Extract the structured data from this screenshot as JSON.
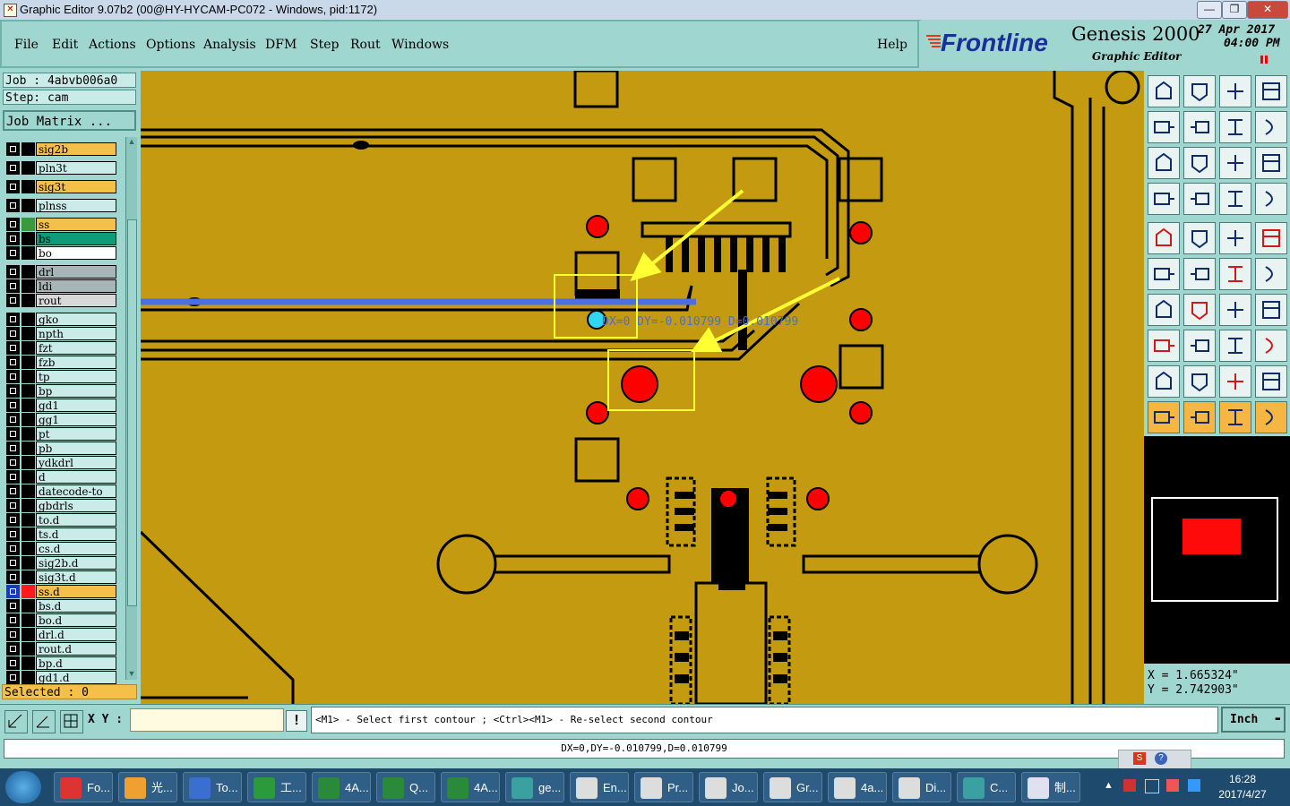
{
  "window": {
    "title": "Graphic Editor 9.07b2 (00@HY-HYCAM-PC072 - Windows, pid:1172)",
    "controls": [
      "—",
      "❐",
      "✕"
    ]
  },
  "menubar": {
    "items": [
      "File",
      "Edit",
      "Actions",
      "Options",
      "Analysis",
      "DFM",
      "Step",
      "Rout",
      "Windows"
    ],
    "help": "Help"
  },
  "brand": {
    "logo": "Frontline",
    "product": "Genesis 2000",
    "subtitle": "Graphic Editor",
    "date": "27 Apr 2017",
    "time": "04:00 PM"
  },
  "job": {
    "job_label": "Job : 4abvb006a0",
    "step_label": "Step: cam",
    "matrix_button": "Job Matrix ...",
    "selected": "Selected : 0"
  },
  "layers": [
    {
      "name": "sig2b",
      "color": "#f5c04a",
      "swatch": "#000000"
    },
    {
      "name": "pln3t",
      "color": "#c9ece8",
      "swatch": "#000000"
    },
    {
      "name": "sig3t",
      "color": "#f5c04a",
      "swatch": "#000000"
    },
    {
      "name": "plnss",
      "color": "#c9ece8",
      "swatch": "#000000"
    },
    {
      "name": "ss",
      "color": "#f5c04a",
      "swatch": "#3a9a3a"
    },
    {
      "name": "bs",
      "color": "#0f9a7a",
      "swatch": "#000000"
    },
    {
      "name": "bo",
      "color": "#ffffff",
      "swatch": "#000000"
    },
    {
      "name": "drl",
      "color": "#a9b4b6",
      "swatch": "#000000"
    },
    {
      "name": "ldi",
      "color": "#a9b4b6",
      "swatch": "#000000"
    },
    {
      "name": "rout",
      "color": "#d8d8d8",
      "swatch": "#000000"
    },
    {
      "name": "gko",
      "color": "#c9ece8",
      "swatch": "#000000"
    },
    {
      "name": "npth",
      "color": "#c9ece8",
      "swatch": "#000000"
    },
    {
      "name": "fzt",
      "color": "#c9ece8",
      "swatch": "#000000"
    },
    {
      "name": "fzb",
      "color": "#c9ece8",
      "swatch": "#000000"
    },
    {
      "name": "tp",
      "color": "#c9ece8",
      "swatch": "#000000"
    },
    {
      "name": "bp",
      "color": "#c9ece8",
      "swatch": "#000000"
    },
    {
      "name": "gd1",
      "color": "#c9ece8",
      "swatch": "#000000"
    },
    {
      "name": "gg1",
      "color": "#c9ece8",
      "swatch": "#000000"
    },
    {
      "name": "pt",
      "color": "#c9ece8",
      "swatch": "#000000"
    },
    {
      "name": "pb",
      "color": "#c9ece8",
      "swatch": "#000000"
    },
    {
      "name": "ydkdrl",
      "color": "#c9ece8",
      "swatch": "#000000"
    },
    {
      "name": "d",
      "color": "#c9ece8",
      "swatch": "#000000"
    },
    {
      "name": "datecode-to",
      "color": "#c9ece8",
      "swatch": "#000000"
    },
    {
      "name": "gbdrls",
      "color": "#c9ece8",
      "swatch": "#000000"
    },
    {
      "name": "to.d",
      "color": "#c9ece8",
      "swatch": "#000000"
    },
    {
      "name": "ts.d",
      "color": "#c9ece8",
      "swatch": "#000000"
    },
    {
      "name": "cs.d",
      "color": "#c9ece8",
      "swatch": "#000000"
    },
    {
      "name": "sig2b.d",
      "color": "#c9ece8",
      "swatch": "#000000"
    },
    {
      "name": "sig3t.d",
      "color": "#c9ece8",
      "swatch": "#000000"
    },
    {
      "name": "ss.d",
      "color": "#f5c04a",
      "swatch": "#ff1a1a",
      "active": true
    },
    {
      "name": "bs.d",
      "color": "#c9ece8",
      "swatch": "#000000"
    },
    {
      "name": "bo.d",
      "color": "#c9ece8",
      "swatch": "#000000"
    },
    {
      "name": "drl.d",
      "color": "#c9ece8",
      "swatch": "#000000"
    },
    {
      "name": "rout.d",
      "color": "#c9ece8",
      "swatch": "#000000"
    },
    {
      "name": "bp.d",
      "color": "#c9ece8",
      "swatch": "#000000"
    },
    {
      "name": "gd1.d",
      "color": "#c9ece8",
      "swatch": "#000000"
    }
  ],
  "canvas": {
    "measure_overlay": "DX=0 DY=-0.010799 D=0.010799",
    "board_color": "#c39a10",
    "pad_color": "#ff0000",
    "highlight_color": "#ffff33",
    "selected_trace_color": "#4d6ee0"
  },
  "coordinates": {
    "x": "X = 1.665324\"",
    "y": "Y = 2.742903\""
  },
  "command": {
    "xy_label": "X Y :",
    "xy_value": "",
    "prompt": "<M1> - Select first contour ; <Ctrl><M1> - Re-select second contour",
    "units": "Inch",
    "status": "DX=0,DY=-0.010799,D=0.010799"
  },
  "taskbar": {
    "items": [
      "Fo...",
      "光...",
      "To...",
      "工...",
      "4A...",
      "Q...",
      "4A...",
      "ge...",
      "En...",
      "Pr...",
      "Jo...",
      "Gr...",
      "4a...",
      "Di...",
      "C...",
      "制..."
    ],
    "clock_time": "16:28",
    "clock_date": "2017/4/27"
  }
}
